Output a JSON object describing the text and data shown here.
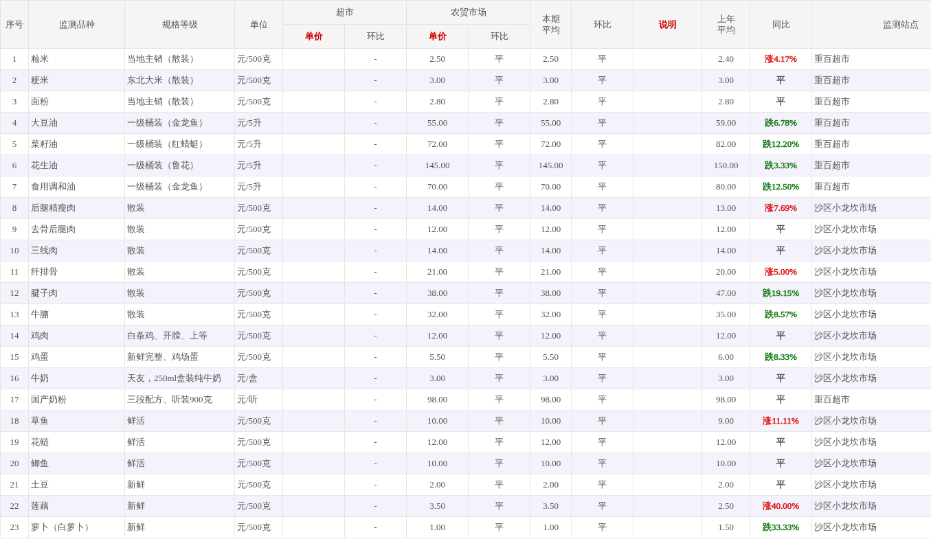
{
  "table": {
    "columns": [
      {
        "label": "序号",
        "highlighted": false
      },
      {
        "label": "监测品种",
        "highlighted": false
      },
      {
        "label": "规格等级",
        "highlighted": false
      },
      {
        "label": "单位",
        "highlighted": false
      },
      {
        "label": "超市",
        "highlighted": false,
        "children": [
          {
            "label": "单价",
            "highlighted": true
          },
          {
            "label": "环比",
            "highlighted": false
          }
        ]
      },
      {
        "label": "农贸市场",
        "highlighted": false,
        "children": [
          {
            "label": "单价",
            "highlighted": true
          },
          {
            "label": "环比",
            "highlighted": false
          }
        ]
      },
      {
        "label": "本期平均",
        "highlighted": false
      },
      {
        "label": "环比",
        "highlighted": false
      },
      {
        "label": "说明",
        "highlighted": true
      },
      {
        "label": "上年平均",
        "highlighted": false
      },
      {
        "label": "同比",
        "highlighted": false
      },
      {
        "label": "监测站点",
        "highlighted": false
      }
    ],
    "rows": [
      {
        "no": "1",
        "name": "籼米",
        "spec": "当地主销（散装）",
        "unit": "元/500克",
        "super_ratio": "-",
        "market_price": "2.50",
        "market_ratio": "平",
        "avg": "2.50",
        "avg_ratio": "平",
        "last_avg": "2.40",
        "yoy": "涨4.17%",
        "color": "#dd1111",
        "station": "重百超市"
      },
      {
        "no": "2",
        "name": "粳米",
        "spec": "东北大米（散装）",
        "unit": "元/500克",
        "super_ratio": "-",
        "market_price": "3.00",
        "market_ratio": "平",
        "avg": "3.00",
        "avg_ratio": "平",
        "last_avg": "3.00",
        "yoy": "平",
        "color": "#555555",
        "station": "重百超市"
      },
      {
        "no": "3",
        "name": "面粉",
        "spec": "当地主销（散装）",
        "unit": "元/500克",
        "super_ratio": "-",
        "market_price": "2.80",
        "market_ratio": "平",
        "avg": "2.80",
        "avg_ratio": "平",
        "last_avg": "2.80",
        "yoy": "平",
        "color": "#555555",
        "station": "重百超市"
      },
      {
        "no": "4",
        "name": "大豆油",
        "spec": "一级桶装（金龙鱼）",
        "unit": "元/5升",
        "super_ratio": "-",
        "market_price": "55.00",
        "market_ratio": "平",
        "avg": "55.00",
        "avg_ratio": "平",
        "last_avg": "59.00",
        "yoy": "跌6.78%",
        "color": "#117711",
        "station": "重百超市"
      },
      {
        "no": "5",
        "name": "菜籽油",
        "spec": "一级桶装（红蜻蜓）",
        "unit": "元/5升",
        "super_ratio": "-",
        "market_price": "72.00",
        "market_ratio": "平",
        "avg": "72.00",
        "avg_ratio": "平",
        "last_avg": "82.00",
        "yoy": "跌12.20%",
        "color": "#117711",
        "station": "重百超市"
      },
      {
        "no": "6",
        "name": "花生油",
        "spec": "一级桶装（鲁花）",
        "unit": "元/5升",
        "super_ratio": "-",
        "market_price": "145.00",
        "market_ratio": "平",
        "avg": "145.00",
        "avg_ratio": "平",
        "last_avg": "150.00",
        "yoy": "跌3.33%",
        "color": "#117711",
        "station": "重百超市"
      },
      {
        "no": "7",
        "name": "食用调和油",
        "spec": "一级桶装（金龙鱼）",
        "unit": "元/5升",
        "super_ratio": "-",
        "market_price": "70.00",
        "market_ratio": "平",
        "avg": "70.00",
        "avg_ratio": "平",
        "last_avg": "80.00",
        "yoy": "跌12.50%",
        "color": "#117711",
        "station": "重百超市"
      },
      {
        "no": "8",
        "name": "后腿精瘦肉",
        "spec": "散装",
        "unit": "元/500克",
        "super_ratio": "-",
        "market_price": "14.00",
        "market_ratio": "平",
        "avg": "14.00",
        "avg_ratio": "平",
        "last_avg": "13.00",
        "yoy": "涨7.69%",
        "color": "#dd1111",
        "station": "沙区小龙坎市场"
      },
      {
        "no": "9",
        "name": "去骨后腿肉",
        "spec": "散装",
        "unit": "元/500克",
        "super_ratio": "-",
        "market_price": "12.00",
        "market_ratio": "平",
        "avg": "12.00",
        "avg_ratio": "平",
        "last_avg": "12.00",
        "yoy": "平",
        "color": "#555555",
        "station": "沙区小龙坎市场"
      },
      {
        "no": "10",
        "name": "三线肉",
        "spec": "散装",
        "unit": "元/500克",
        "super_ratio": "-",
        "market_price": "14.00",
        "market_ratio": "平",
        "avg": "14.00",
        "avg_ratio": "平",
        "last_avg": "14.00",
        "yoy": "平",
        "color": "#555555",
        "station": "沙区小龙坎市场"
      },
      {
        "no": "11",
        "name": "纤排骨",
        "spec": "散装",
        "unit": "元/500克",
        "super_ratio": "-",
        "market_price": "21.00",
        "market_ratio": "平",
        "avg": "21.00",
        "avg_ratio": "平",
        "last_avg": "20.00",
        "yoy": "涨5.00%",
        "color": "#dd1111",
        "station": "沙区小龙坎市场"
      },
      {
        "no": "12",
        "name": "腱子肉",
        "spec": "散装",
        "unit": "元/500克",
        "super_ratio": "-",
        "market_price": "38.00",
        "market_ratio": "平",
        "avg": "38.00",
        "avg_ratio": "平",
        "last_avg": "47.00",
        "yoy": "跌19.15%",
        "color": "#117711",
        "station": "沙区小龙坎市场"
      },
      {
        "no": "13",
        "name": "牛腩",
        "spec": "散装",
        "unit": "元/500克",
        "super_ratio": "-",
        "market_price": "32.00",
        "market_ratio": "平",
        "avg": "32.00",
        "avg_ratio": "平",
        "last_avg": "35.00",
        "yoy": "跌8.57%",
        "color": "#117711",
        "station": "沙区小龙坎市场"
      },
      {
        "no": "14",
        "name": "鸡肉",
        "spec": "白条鸡、开膛、上等",
        "unit": "元/500克",
        "super_ratio": "-",
        "market_price": "12.00",
        "market_ratio": "平",
        "avg": "12.00",
        "avg_ratio": "平",
        "last_avg": "12.00",
        "yoy": "平",
        "color": "#555555",
        "station": "沙区小龙坎市场"
      },
      {
        "no": "15",
        "name": "鸡蛋",
        "spec": "新鲜完整、鸡场蛋",
        "unit": "元/500克",
        "super_ratio": "-",
        "market_price": "5.50",
        "market_ratio": "平",
        "avg": "5.50",
        "avg_ratio": "平",
        "last_avg": "6.00",
        "yoy": "跌8.33%",
        "color": "#117711",
        "station": "沙区小龙坎市场"
      },
      {
        "no": "16",
        "name": "牛奶",
        "spec": "天友，250ml盒装纯牛奶",
        "unit": "元/盒",
        "super_ratio": "-",
        "market_price": "3.00",
        "market_ratio": "平",
        "avg": "3.00",
        "avg_ratio": "平",
        "last_avg": "3.00",
        "yoy": "平",
        "color": "#555555",
        "station": "沙区小龙坎市场"
      },
      {
        "no": "17",
        "name": "国产奶粉",
        "spec": "三段配方、听装900克",
        "unit": "元/听",
        "super_ratio": "-",
        "market_price": "98.00",
        "market_ratio": "平",
        "avg": "98.00",
        "avg_ratio": "平",
        "last_avg": "98.00",
        "yoy": "平",
        "color": "#555555",
        "station": "重百超市"
      },
      {
        "no": "18",
        "name": "草鱼",
        "spec": "鲜活",
        "unit": "元/500克",
        "super_ratio": "-",
        "market_price": "10.00",
        "market_ratio": "平",
        "avg": "10.00",
        "avg_ratio": "平",
        "last_avg": "9.00",
        "yoy": "涨11.11%",
        "color": "#dd1111",
        "station": "沙区小龙坎市场"
      },
      {
        "no": "19",
        "name": "花鲢",
        "spec": "鲜活",
        "unit": "元/500克",
        "super_ratio": "-",
        "market_price": "12.00",
        "market_ratio": "平",
        "avg": "12.00",
        "avg_ratio": "平",
        "last_avg": "12.00",
        "yoy": "平",
        "color": "#555555",
        "station": "沙区小龙坎市场"
      },
      {
        "no": "20",
        "name": "鲫鱼",
        "spec": "鲜活",
        "unit": "元/500克",
        "super_ratio": "-",
        "market_price": "10.00",
        "market_ratio": "平",
        "avg": "10.00",
        "avg_ratio": "平",
        "last_avg": "10.00",
        "yoy": "平",
        "color": "#555555",
        "station": "沙区小龙坎市场"
      },
      {
        "no": "21",
        "name": "土豆",
        "spec": "新鲜",
        "unit": "元/500克",
        "super_ratio": "-",
        "market_price": "2.00",
        "market_ratio": "平",
        "avg": "2.00",
        "avg_ratio": "平",
        "last_avg": "2.00",
        "yoy": "平",
        "color": "#555555",
        "station": "沙区小龙坎市场"
      },
      {
        "no": "22",
        "name": "莲藕",
        "spec": "新鲜",
        "unit": "元/500克",
        "super_ratio": "-",
        "market_price": "3.50",
        "market_ratio": "平",
        "avg": "3.50",
        "avg_ratio": "平",
        "last_avg": "2.50",
        "yoy": "涨40.00%",
        "color": "#dd1111",
        "station": "沙区小龙坎市场"
      },
      {
        "no": "23",
        "name": "萝卜（白萝卜）",
        "spec": "新鲜",
        "unit": "元/500克",
        "super_ratio": "-",
        "market_price": "1.00",
        "market_ratio": "平",
        "avg": "1.00",
        "avg_ratio": "平",
        "last_avg": "1.50",
        "yoy": "跌33.33%",
        "color": "#117711",
        "station": "沙区小龙坎市场"
      }
    ]
  }
}
